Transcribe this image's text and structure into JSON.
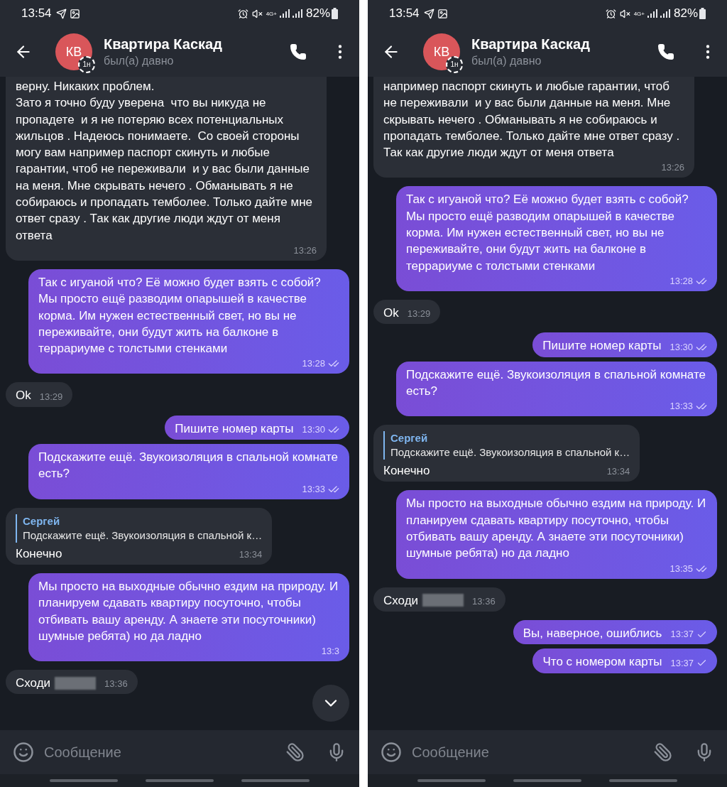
{
  "screens": [
    {
      "status_bar": {
        "time": "13:54",
        "network": "4G+",
        "battery": "82%"
      },
      "header": {
        "avatar": "КВ",
        "avatar_badge": "1н",
        "title": "Квартира Каскад",
        "subtitle": "был(а) давно"
      },
      "messages": [
        {
          "kind": "incoming",
          "cut_top": true,
          "redacted": false,
          "text": "верну. Никаких проблем.\nЗато я точно буду уверена  что вы никуда не пропадете  и я не потеряю всех потенциальных жильцов . Надеюсь понимаете.  Со своей стороны могу вам например паспорт скинуть и любые гарантии, чтоб не переживали  и у вас были данные на меня. Мне скрывать нечего . Обманывать я не собираюсь и пропадать темболее. Только дайте мне ответ сразу . Так как другие люди ждут от меня ответа",
          "time": "13:26"
        },
        {
          "kind": "outgoing",
          "cut_top": false,
          "redacted": false,
          "text": "Так с игуаной что? Её можно будет взять с собой?\nМы просто ещё разводим опарышей в качестве корма. Им нужен естественный свет, но вы не переживайте, они будут жить на балконе в террариуме с толстыми стенками",
          "time": "13:28",
          "read": true
        },
        {
          "kind": "incoming",
          "cut_top": false,
          "redacted": false,
          "text": "Ok",
          "time": "13:29"
        },
        {
          "kind": "outgoing",
          "cut_top": false,
          "redacted": false,
          "text": "Пишите номер карты",
          "time": "13:30",
          "read": true
        },
        {
          "kind": "outgoing",
          "cut_top": false,
          "redacted": false,
          "text": "Подскажите ещё. Звукоизоляция в спальной комнате есть?",
          "time": "13:33",
          "read": true
        },
        {
          "kind": "incoming",
          "cut_top": false,
          "redacted": false,
          "reply": {
            "author": "Сергей",
            "text": "Подскажите ещё. Звукоизоляция в спальной к…"
          },
          "text": "Конечно",
          "time": "13:34"
        },
        {
          "kind": "outgoing",
          "cut_top": false,
          "redacted": false,
          "text": "Мы просто на выходные обычно ездим на природу. И планируем сдавать квартиру посуточно, чтобы отбивать вашу аренду. А знаете эти посуточники) шумные ребята) но да ладно",
          "time": "13:3"
        },
        {
          "kind": "incoming",
          "cut_top": false,
          "redacted": true,
          "text": "Сходи",
          "time": "13:36"
        }
      ],
      "scroll_down_button": true,
      "input": {
        "placeholder": "Сообщение"
      }
    },
    {
      "status_bar": {
        "time": "13:54",
        "network": "4G+",
        "battery": "82%"
      },
      "header": {
        "avatar": "КВ",
        "avatar_badge": "1н",
        "title": "Квартира Каскад",
        "subtitle": "был(а) давно"
      },
      "messages": [
        {
          "kind": "incoming",
          "cut_top": true,
          "redacted": false,
          "text": "например паспорт скинуть и любые гарантии, чтоб не переживали  и у вас были данные на меня. Мне скрывать нечего . Обманывать я не собираюсь и пропадать темболее. Только дайте мне ответ сразу . Так как другие люди ждут от меня ответа",
          "time": "13:26"
        },
        {
          "kind": "outgoing",
          "cut_top": false,
          "redacted": false,
          "text": "Так с игуаной что? Её можно будет взять с собой?\nМы просто ещё разводим опарышей в качестве корма. Им нужен естественный свет, но вы не переживайте, они будут жить на балконе в террариуме с толстыми стенками",
          "time": "13:28",
          "read": true
        },
        {
          "kind": "incoming",
          "cut_top": false,
          "redacted": false,
          "text": "Ok",
          "time": "13:29"
        },
        {
          "kind": "outgoing",
          "cut_top": false,
          "redacted": false,
          "text": "Пишите номер карты",
          "time": "13:30",
          "read": true
        },
        {
          "kind": "outgoing",
          "cut_top": false,
          "redacted": false,
          "text": "Подскажите ещё. Звукоизоляция в спальной комнате есть?",
          "time": "13:33",
          "read": true
        },
        {
          "kind": "incoming",
          "cut_top": false,
          "redacted": false,
          "reply": {
            "author": "Сергей",
            "text": "Подскажите ещё. Звукоизоляция в спальной к…"
          },
          "text": "Конечно",
          "time": "13:34"
        },
        {
          "kind": "outgoing",
          "cut_top": false,
          "redacted": false,
          "text": "Мы просто на выходные обычно ездим на природу. И планируем сдавать квартиру посуточно, чтобы отбивать вашу аренду. А знаете эти посуточники) шумные ребята) но да ладно",
          "time": "13:35",
          "read": true
        },
        {
          "kind": "incoming",
          "cut_top": false,
          "redacted": true,
          "text": "Сходи",
          "time": "13:36"
        },
        {
          "kind": "outgoing",
          "cut_top": false,
          "redacted": false,
          "text": "Вы, наверное, ошиблись",
          "time": "13:37",
          "read": false
        },
        {
          "kind": "outgoing",
          "cut_top": false,
          "redacted": false,
          "text": "Что с номером карты",
          "time": "13:37",
          "read": false
        }
      ],
      "input": {
        "placeholder": "Сообщение"
      }
    }
  ]
}
